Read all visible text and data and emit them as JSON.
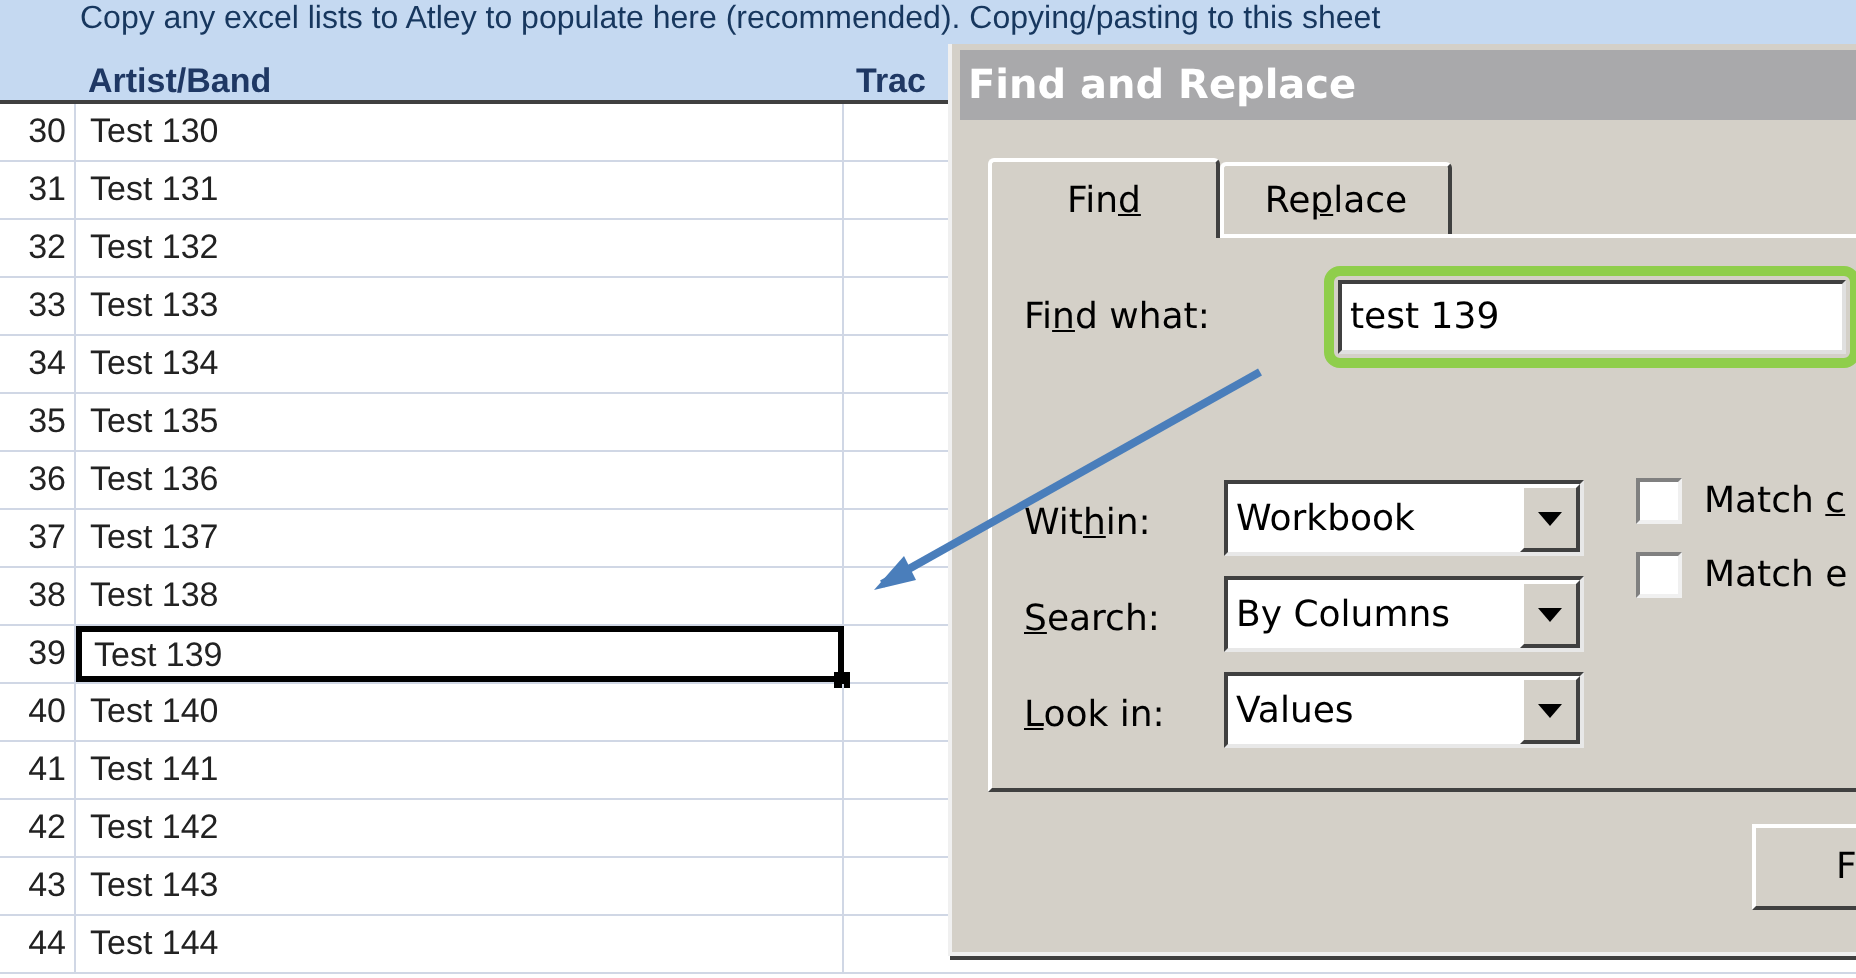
{
  "sheet": {
    "banner": "Copy  any excel lists to Atley to populate here (recommended). Copying/pasting to this sheet",
    "columns": [
      "Artist/Band",
      "Trac"
    ],
    "rows": [
      {
        "number": "30",
        "artist": "Test 130",
        "selected": false
      },
      {
        "number": "31",
        "artist": "Test 131",
        "selected": false
      },
      {
        "number": "32",
        "artist": "Test 132",
        "selected": false
      },
      {
        "number": "33",
        "artist": "Test 133",
        "selected": false
      },
      {
        "number": "34",
        "artist": "Test 134",
        "selected": false
      },
      {
        "number": "35",
        "artist": "Test 135",
        "selected": false
      },
      {
        "number": "36",
        "artist": "Test 136",
        "selected": false
      },
      {
        "number": "37",
        "artist": "Test 137",
        "selected": false
      },
      {
        "number": "38",
        "artist": "Test 138",
        "selected": false
      },
      {
        "number": "39",
        "artist": "Test 139",
        "selected": true
      },
      {
        "number": "40",
        "artist": "Test 140",
        "selected": false
      },
      {
        "number": "41",
        "artist": "Test 141",
        "selected": false
      },
      {
        "number": "42",
        "artist": "Test 142",
        "selected": false
      },
      {
        "number": "43",
        "artist": "Test 143",
        "selected": false
      },
      {
        "number": "44",
        "artist": "Test 144",
        "selected": false
      }
    ]
  },
  "dialog": {
    "title": "Find and Replace",
    "tabs": [
      {
        "label": {
          "before": "Fin",
          "key": "d"
        },
        "selected": true
      },
      {
        "label": {
          "before": "Re",
          "key": "p",
          "after": "lace"
        },
        "selected": false
      }
    ],
    "find_what": {
      "label": {
        "before": "Fi",
        "key": "n",
        "after": "d what:"
      },
      "value": "test 139"
    },
    "dropdowns": [
      {
        "label": {
          "before": "Wit",
          "key": "h",
          "after": "in:"
        },
        "value": "Workbook"
      },
      {
        "label": {
          "key": "S",
          "after": "earch:"
        },
        "value": "By Columns"
      },
      {
        "label": {
          "key": "L",
          "after": "ook in:"
        },
        "value": "Values"
      }
    ],
    "checkboxes": [
      {
        "label": {
          "before": "Match ",
          "key": "c"
        },
        "checked": false
      },
      {
        "label": {
          "before": "Match e"
        },
        "checked": false
      }
    ],
    "button": {
      "label": "F"
    }
  }
}
